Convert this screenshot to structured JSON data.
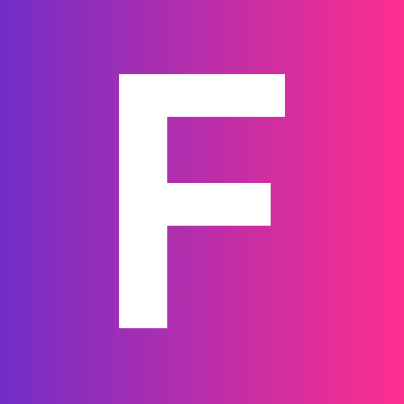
{
  "logo": {
    "letter": "F",
    "gradient_start": "#722EC6",
    "gradient_end": "#FE2E8E",
    "glyph_color": "#FFFFFF"
  }
}
